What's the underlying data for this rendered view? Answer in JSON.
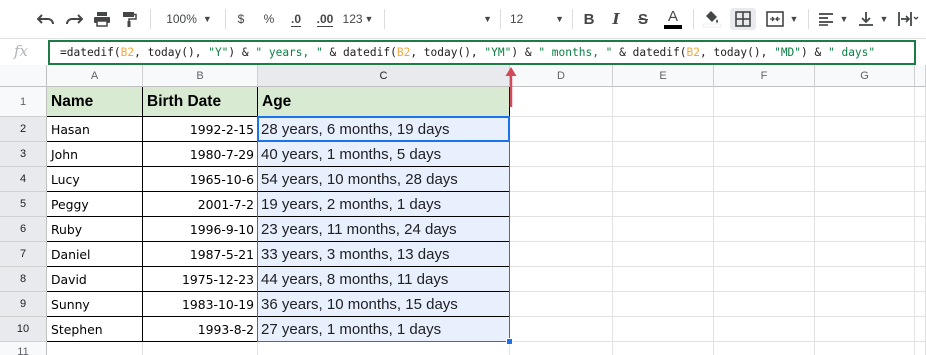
{
  "toolbar": {
    "zoom": "100%",
    "currency": "$",
    "percent": "%",
    "decimal_decrease": ".0",
    "decimal_increase": ".00",
    "number_format": "123",
    "font_size": "12",
    "bold": "B",
    "italic": "I",
    "strikethrough": "S",
    "text_color": "A",
    "text_color_underline": "#000000",
    "icons": [
      "undo-icon",
      "redo-icon",
      "print-icon",
      "paint-format-icon",
      "fill-color-icon",
      "borders-icon",
      "merge-cells-icon",
      "align-left-icon",
      "vertical-align-icon",
      "text-wrap-icon"
    ]
  },
  "formula_bar": {
    "fx": "fx",
    "formula_parts": [
      {
        "t": "=datedif(",
        "k": "plain"
      },
      {
        "t": "B2",
        "k": "ref"
      },
      {
        "t": ", today(), ",
        "k": "plain"
      },
      {
        "t": "\"Y\"",
        "k": "str"
      },
      {
        "t": ") & ",
        "k": "plain"
      },
      {
        "t": "\" years, \"",
        "k": "str"
      },
      {
        "t": " & datedif(",
        "k": "plain"
      },
      {
        "t": "B2",
        "k": "ref"
      },
      {
        "t": ", today(), ",
        "k": "plain"
      },
      {
        "t": "\"YM\"",
        "k": "str"
      },
      {
        "t": ") & ",
        "k": "plain"
      },
      {
        "t": "\" months, \"",
        "k": "str"
      },
      {
        "t": " & datedif(",
        "k": "plain"
      },
      {
        "t": "B2",
        "k": "ref"
      },
      {
        "t": ", today(), ",
        "k": "plain"
      },
      {
        "t": "\"MD\"",
        "k": "str"
      },
      {
        "t": ") & ",
        "k": "plain"
      },
      {
        "t": "\" days\"",
        "k": "str"
      }
    ]
  },
  "columns": [
    "A",
    "B",
    "C",
    "D",
    "E",
    "F",
    "G"
  ],
  "row_numbers": [
    "1",
    "2",
    "3",
    "4",
    "5",
    "6",
    "7",
    "8",
    "9",
    "10",
    "11"
  ],
  "headers": {
    "name": "Name",
    "birth_date": "Birth Date",
    "age": "Age"
  },
  "rows": [
    {
      "name": "Hasan",
      "birth_date": "1992-2-15",
      "age": "28 years, 6 months, 19 days"
    },
    {
      "name": "John",
      "birth_date": "1980-7-29",
      "age": "40 years, 1 months, 5 days"
    },
    {
      "name": "Lucy",
      "birth_date": "1965-10-6",
      "age": "54 years, 10 months, 28 days"
    },
    {
      "name": "Peggy",
      "birth_date": "2001-7-2",
      "age": "19 years, 2 months, 1 days"
    },
    {
      "name": "Ruby",
      "birth_date": "1996-9-10",
      "age": "23 years, 11 months, 24 days"
    },
    {
      "name": "Daniel",
      "birth_date": "1987-5-21",
      "age": "33 years, 3 months, 13 days"
    },
    {
      "name": "David",
      "birth_date": "1975-12-23",
      "age": "44 years, 8 months, 11 days"
    },
    {
      "name": "Sunny",
      "birth_date": "1983-10-19",
      "age": "36 years, 10 months, 15 days"
    },
    {
      "name": "Stephen",
      "birth_date": "1993-8-2",
      "age": "27 years, 1 months, 1 days"
    }
  ],
  "colors": {
    "header_fill": "#d9ead3",
    "selection_fill": "#e8f0fe",
    "selection_border": "#1a73e8",
    "formula_border": "#1e7b45",
    "annotation_arrow": "#d04a5b"
  }
}
